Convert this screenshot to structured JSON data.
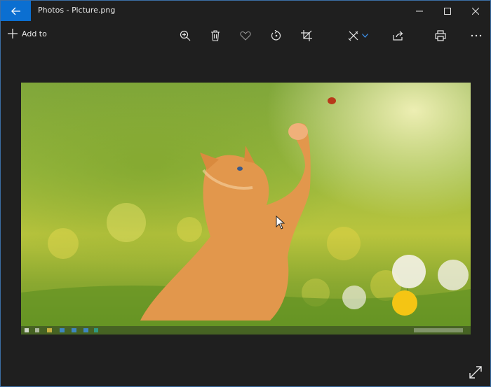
{
  "window": {
    "title": "Photos - Picture.png"
  },
  "toolbar": {
    "add_to_label": "Add to",
    "icons": [
      "zoom-in-icon",
      "delete-icon",
      "favorite-icon",
      "rotate-icon",
      "crop-icon",
      "edit-draw-icon",
      "share-icon",
      "print-icon",
      "more-icon"
    ]
  },
  "colors": {
    "accent": "#0b6fd1",
    "background": "#1f1f1f",
    "border": "#3b6ea5"
  }
}
